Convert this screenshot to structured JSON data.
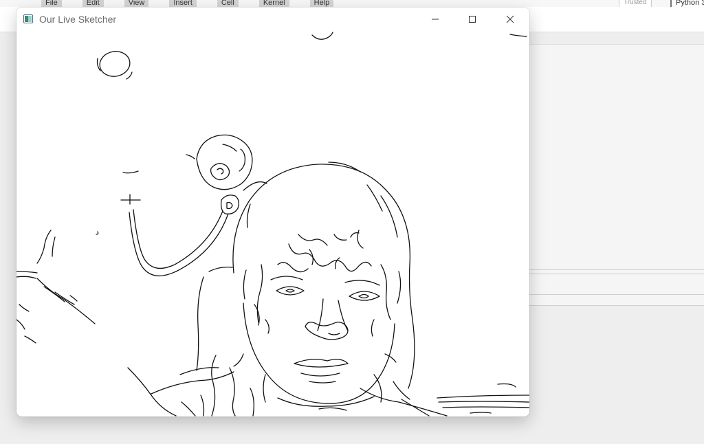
{
  "background": {
    "menu_items": [
      "File",
      "Edit",
      "View",
      "Insert",
      "Cell",
      "Kernel",
      "Help"
    ],
    "trusted_label": "Trusted",
    "kernel_label": "Python 3"
  },
  "window": {
    "title": "Our Live Sketcher",
    "controls": {
      "minimize_icon": "minimize-icon",
      "maximize_icon": "maximize-icon",
      "close_icon": "close-icon"
    }
  },
  "colors": {
    "sketch_line": "#111111",
    "canvas_bg": "#ffffff",
    "desktop_bg": "#eeeeee"
  }
}
